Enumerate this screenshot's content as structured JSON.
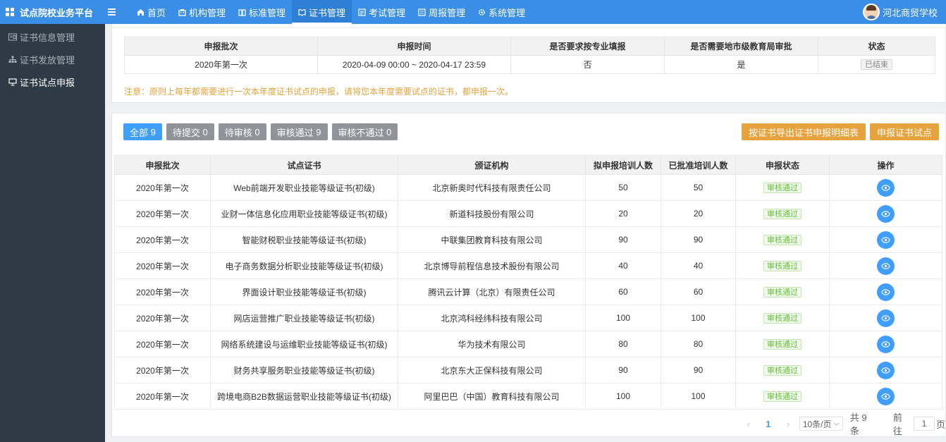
{
  "app": {
    "title": "试点院校业务平台"
  },
  "nav": [
    {
      "label": "首页",
      "icon": "home-icon"
    },
    {
      "label": "机构管理",
      "icon": "building-icon"
    },
    {
      "label": "标准管理",
      "icon": "book-icon"
    },
    {
      "label": "证书管理",
      "icon": "certificate-icon",
      "active": true
    },
    {
      "label": "考试管理",
      "icon": "exam-icon"
    },
    {
      "label": "周报管理",
      "icon": "report-icon"
    },
    {
      "label": "系统管理",
      "icon": "gear-icon"
    }
  ],
  "user": {
    "name": "河北商贸学校"
  },
  "sidebar": [
    {
      "label": "证书信息管理",
      "icon": "id-card-icon"
    },
    {
      "label": "证书发放管理",
      "icon": "org-tree-icon"
    },
    {
      "label": "证书试点申报",
      "icon": "presentation-icon",
      "active": true
    }
  ],
  "batch_table": {
    "headers": [
      "申报批次",
      "申报时间",
      "是否要求按专业填报",
      "是否需要地市级教育局审批",
      "状态"
    ],
    "row": {
      "batch": "2020年第一次",
      "time": "2020-04-09 00:00 ~ 2020-04-17 23:59",
      "by_major": "否",
      "need_approval": "是",
      "status": "已结束"
    }
  },
  "notice": "注意：原则上每年都需要进行一次本年度证书试点的申报，请将您本年度需要试点的证书，都申报一次。",
  "filters": [
    {
      "label": "全部",
      "count": "9",
      "active": true
    },
    {
      "label": "待提交",
      "count": "0"
    },
    {
      "label": "待审核",
      "count": "0"
    },
    {
      "label": "审核通过",
      "count": "9"
    },
    {
      "label": "审核不通过",
      "count": "0"
    }
  ],
  "actions": {
    "export_label": "按证书导出证书申报明细表",
    "apply_label": "申报证书试点"
  },
  "apply_table": {
    "headers": [
      "申报批次",
      "试点证书",
      "颁证机构",
      "拟申报培训人数",
      "已批准培训人数",
      "申报状态",
      "操作"
    ],
    "rows": [
      {
        "batch": "2020年第一次",
        "cert": "Web前端开发职业技能等级证书(初级)",
        "org": "北京新奥时代科技有限责任公司",
        "planned": "50",
        "approved": "50",
        "status": "审核通过"
      },
      {
        "batch": "2020年第一次",
        "cert": "业财一体信息化应用职业技能等级证书(初级)",
        "org": "新道科技股份有限公司",
        "planned": "20",
        "approved": "20",
        "status": "审核通过"
      },
      {
        "batch": "2020年第一次",
        "cert": "智能财税职业技能等级证书(初级)",
        "org": "中联集团教育科技有限公司",
        "planned": "90",
        "approved": "90",
        "status": "审核通过"
      },
      {
        "batch": "2020年第一次",
        "cert": "电子商务数据分析职业技能等级证书(初级)",
        "org": "北京博导前程信息技术股份有限公司",
        "planned": "40",
        "approved": "40",
        "status": "审核通过"
      },
      {
        "batch": "2020年第一次",
        "cert": "界面设计职业技能等级证书(初级)",
        "org": "腾讯云计算（北京）有限责任公司",
        "planned": "60",
        "approved": "60",
        "status": "审核通过"
      },
      {
        "batch": "2020年第一次",
        "cert": "网店运营推广职业技能等级证书(初级)",
        "org": "北京鸿科经纬科技有限公司",
        "planned": "100",
        "approved": "100",
        "status": "审核通过"
      },
      {
        "batch": "2020年第一次",
        "cert": "网络系统建设与运维职业技能等级证书(初级)",
        "org": "华为技术有限公司",
        "planned": "80",
        "approved": "80",
        "status": "审核通过"
      },
      {
        "batch": "2020年第一次",
        "cert": "财务共享服务职业技能等级证书(初级)",
        "org": "北京东大正保科技有限公司",
        "planned": "90",
        "approved": "90",
        "status": "审核通过"
      },
      {
        "batch": "2020年第一次",
        "cert": "跨境电商B2B数据运营职业技能等级证书(初级)",
        "org": "阿里巴巴（中国）教育科技有限公司",
        "planned": "100",
        "approved": "100",
        "status": "审核通过"
      }
    ]
  },
  "pagination": {
    "prev": "‹",
    "current": "1",
    "next": "›",
    "page_size": "10条/页",
    "total": "共 9 条",
    "goto_prefix": "前往",
    "goto_value": "1",
    "goto_suffix": "页"
  },
  "colors": {
    "primary": "#409eff",
    "topbar": "#3a8ee6",
    "sidebar": "#2e3a45",
    "warning": "#e6a23c",
    "success": "#67c23a",
    "info": "#909399"
  }
}
